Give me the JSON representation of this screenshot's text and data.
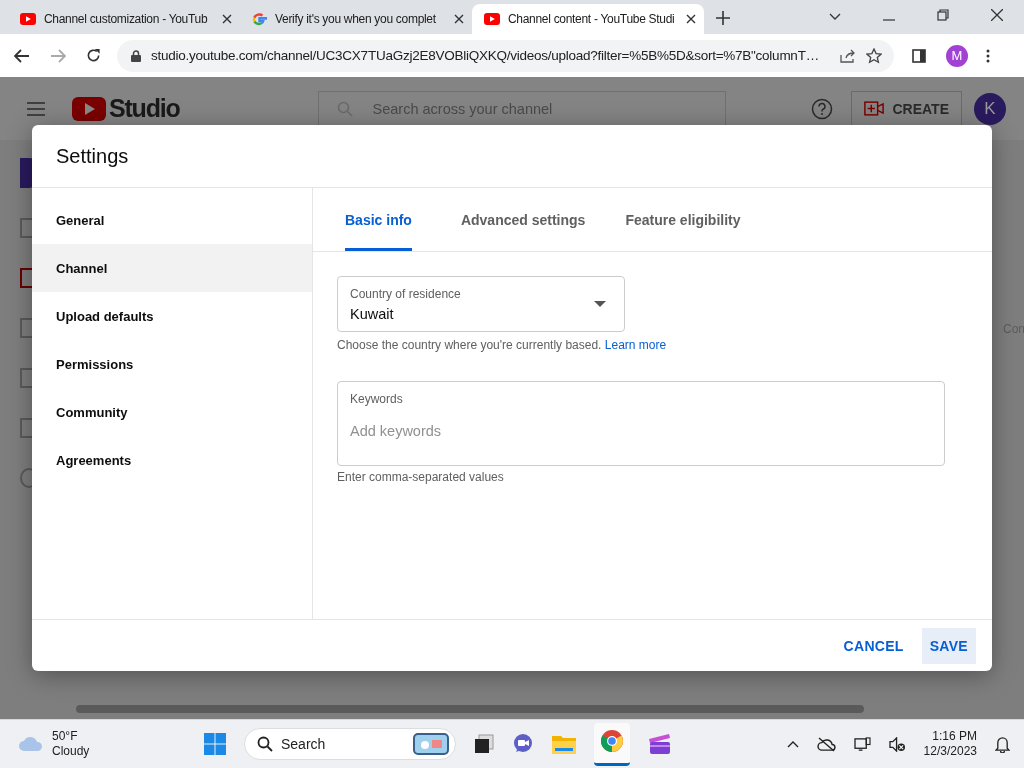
{
  "browser": {
    "tabs": [
      {
        "title": "Channel customization - YouTub",
        "kind": "youtube",
        "selected": false
      },
      {
        "title": "Verify it's you when you complet",
        "kind": "google",
        "selected": false
      },
      {
        "title": "Channel content - YouTube Studi",
        "kind": "youtube",
        "selected": true
      }
    ],
    "url": "studio.youtube.com/channel/UC3CX7TUaGzj2E8VOBliQXKQ/videos/upload?filter=%5B%5D&sort=%7B\"columnT…",
    "profile": "M"
  },
  "studio": {
    "logo": "Studio",
    "search_placeholder": "Search across your channel",
    "create": "CREATE",
    "avatar": "K",
    "side_text": "Con"
  },
  "dialog": {
    "title": "Settings",
    "nav": [
      {
        "label": "General",
        "selected": false
      },
      {
        "label": "Channel",
        "selected": true
      },
      {
        "label": "Upload defaults",
        "selected": false
      },
      {
        "label": "Permissions",
        "selected": false
      },
      {
        "label": "Community",
        "selected": false
      },
      {
        "label": "Agreements",
        "selected": false
      }
    ],
    "tabs": [
      {
        "label": "Basic info",
        "selected": true
      },
      {
        "label": "Advanced settings",
        "selected": false
      },
      {
        "label": "Feature eligibility",
        "selected": false
      }
    ],
    "country": {
      "label": "Country of residence",
      "value": "Kuwait",
      "helper": "Choose the country where you're currently based.",
      "link": "Learn more"
    },
    "keywords": {
      "label": "Keywords",
      "placeholder": "Add keywords",
      "helper": "Enter comma-separated values"
    },
    "cancel": "CANCEL",
    "save": "SAVE"
  },
  "taskbar": {
    "temperature": "50°F",
    "condition": "Cloudy",
    "search": "Search",
    "time": "1:16 PM",
    "date": "12/3/2023"
  }
}
